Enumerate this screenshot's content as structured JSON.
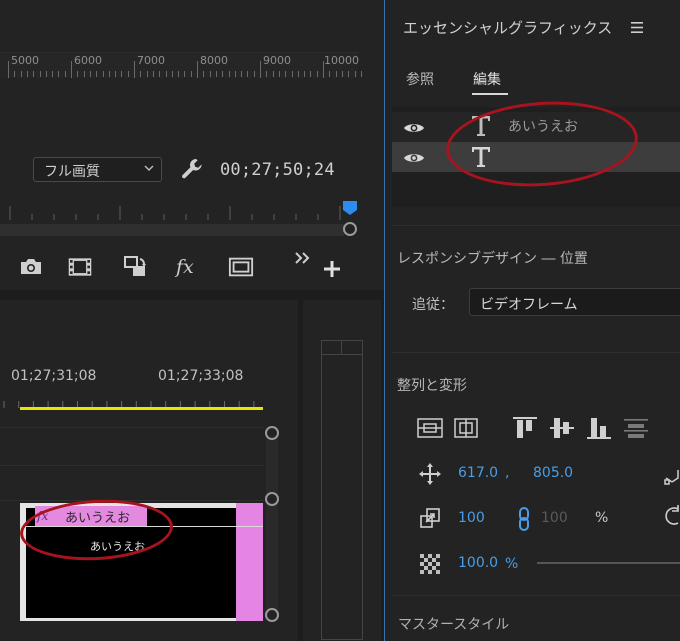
{
  "monitor": {
    "ruler_labels": [
      "5000",
      "6000",
      "7000",
      "8000",
      "9000",
      "10000"
    ],
    "quality_select": "フル画質",
    "timecode": "00;27;50;24",
    "toolbar_icons": [
      "camera-icon",
      "filmstrip-icon",
      "replace-icon",
      "fx-icon",
      "safe-margin-icon",
      "chevron-double-right-icon",
      "plus-icon"
    ],
    "fx_label": "fx"
  },
  "timeline": {
    "timecodes": [
      "01;27;31;08",
      "01;27;33;08"
    ],
    "clip": {
      "fx_badge": "fx",
      "title": "あいうえお",
      "thumbnail_text": "あいうえお"
    }
  },
  "essential_graphics": {
    "title": "エッセンシャルグラフィックス",
    "tabs": [
      {
        "label": "参照",
        "active": false
      },
      {
        "label": "編集",
        "active": true
      }
    ],
    "layers": [
      {
        "label": "あいうえお",
        "selected": false
      },
      {
        "label": "",
        "selected": true
      }
    ],
    "responsive_design_title": "レスポンシブデザイン ― 位置",
    "follow_label": "追従：",
    "follow_value": "ビデオフレーム",
    "align_title": "整列と変形",
    "position_x": "617.0",
    "position_comma": ",",
    "position_y": "805.0",
    "scale": "100",
    "scale_width": "100",
    "scale_unit": "%",
    "opacity": "100.0",
    "opacity_unit": "%",
    "master_style_title": "マスタースタイル"
  },
  "colors": {
    "accent_blue": "#4a9de8",
    "annotation_red": "#a8141e",
    "work_area_yellow": "#e6e600",
    "clip_pink": "#e585e3"
  }
}
